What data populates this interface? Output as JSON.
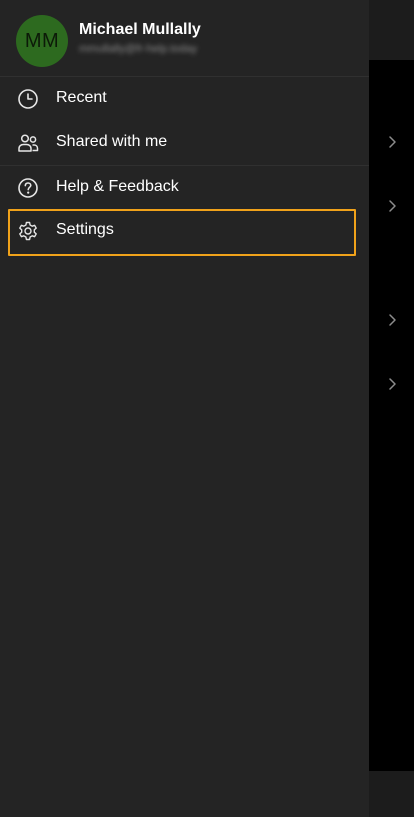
{
  "profile": {
    "initials": "MM",
    "name": "Michael Mullally",
    "email": "mmullally@fr-help.today"
  },
  "menu": {
    "items": [
      {
        "label": "Recent",
        "icon": "clock-icon"
      },
      {
        "label": "Shared with me",
        "icon": "people-icon"
      },
      {
        "label": "Help & Feedback",
        "icon": "help-circle-icon"
      },
      {
        "label": "Settings",
        "icon": "gear-icon"
      }
    ]
  },
  "colors": {
    "drawer_bg": "#242424",
    "avatar_bg": "#2d6a1f",
    "highlight": "#f0a21a"
  }
}
